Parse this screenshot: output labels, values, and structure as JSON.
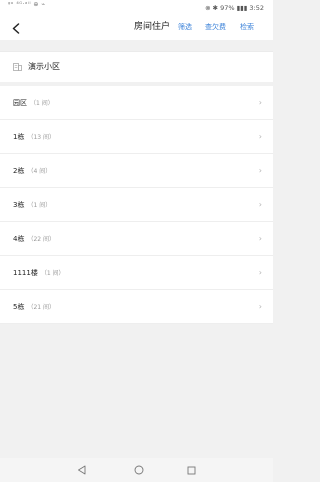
{
  "status_bar": {
    "left_text": "ᵍᵒ ⁴ᴳ·ᵃⁱˡ ⊕ ⌁",
    "right_text": "⊗ ✱ 97% ▮▮▮ 3:52"
  },
  "header": {
    "title": "房间住户",
    "actions": [
      "筛选",
      "查欠费",
      "检索"
    ]
  },
  "community": {
    "name": "演示小区",
    "icon": "building-icon"
  },
  "buildings": [
    {
      "name": "园区",
      "count": "（1 间）"
    },
    {
      "name": "1栋",
      "count": "（13 间）"
    },
    {
      "name": "2栋",
      "count": "（4 间）"
    },
    {
      "name": "3栋",
      "count": "（1 间）"
    },
    {
      "name": "4栋",
      "count": "（22 间）"
    },
    {
      "name": "1111楼",
      "count": "（1 间）"
    },
    {
      "name": "5栋",
      "count": "（21 间）"
    }
  ],
  "chevron": "›",
  "colors": {
    "accent": "#3b82d9",
    "background": "#f1f1f1",
    "row_background": "#ffffff",
    "muted_text": "#999999"
  }
}
